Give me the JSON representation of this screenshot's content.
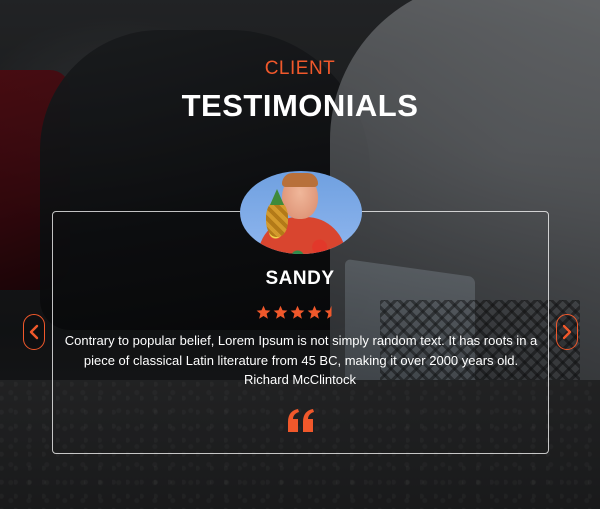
{
  "section": {
    "eyebrow": "CLIENT",
    "title": "TESTIMONIALS"
  },
  "testimonial": {
    "name": "SANDY",
    "rating": 4.5,
    "rating_max": 5,
    "text": "Contrary to popular belief, Lorem Ipsum is not simply random text. It has roots in a piece of classical Latin literature from 45 BC, making it over 2000 years old.",
    "author": "Richard McClintock"
  },
  "colors": {
    "accent": "#f0582b",
    "text": "#ffffff"
  },
  "icons": {
    "prev": "chevron-left-icon",
    "next": "chevron-right-icon",
    "quote": "quote-icon",
    "star": "star-icon"
  }
}
